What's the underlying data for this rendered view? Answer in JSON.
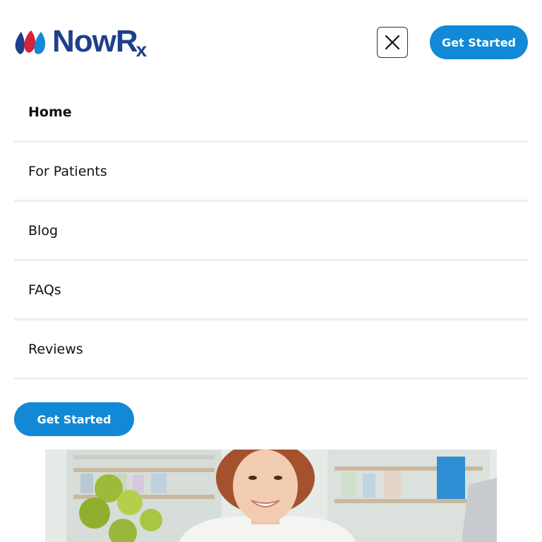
{
  "brand": {
    "name": "NowR",
    "name_suffix": "x",
    "primary_color": "#1e3f8a",
    "accent_color": "#1189d6",
    "drop_colors": [
      "#1e3f8a",
      "#d62339",
      "#1189d6"
    ]
  },
  "header": {
    "close_icon": "close-icon",
    "cta_label": "Get Started"
  },
  "menu": {
    "items": [
      {
        "label": "Home",
        "active": true
      },
      {
        "label": "For Patients",
        "active": false
      },
      {
        "label": "Blog",
        "active": false
      },
      {
        "label": "FAQs",
        "active": false
      },
      {
        "label": "Reviews",
        "active": false
      }
    ],
    "cta_label": "Get Started"
  },
  "hero": {
    "image_subject": "smiling pharmacist in white coat in front of pharmacy shelves"
  }
}
